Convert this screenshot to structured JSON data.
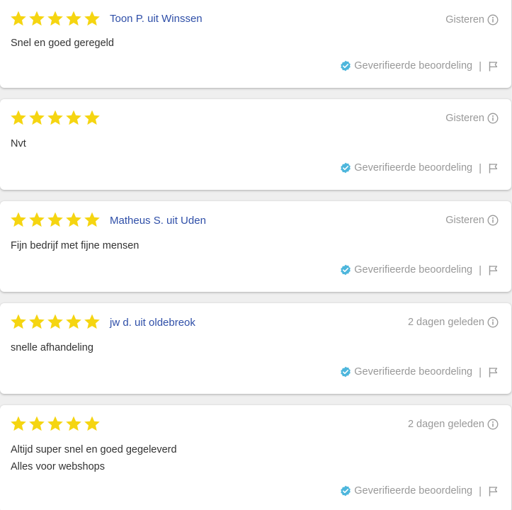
{
  "colors": {
    "star": "#f5d511",
    "author": "#2f4fa8",
    "muted": "#999999",
    "verified_badge": "#4db6dc"
  },
  "reviews": [
    {
      "stars": 5,
      "author": "Toon P. uit Winssen",
      "date": "Gisteren",
      "lines": [
        "Snel en goed geregeld"
      ],
      "verified_label": "Geverifieerde beoordeling",
      "separator": "|"
    },
    {
      "stars": 5,
      "author": "",
      "date": "Gisteren",
      "lines": [
        "Nvt"
      ],
      "verified_label": "Geverifieerde beoordeling",
      "separator": "|"
    },
    {
      "stars": 5,
      "author": "Matheus S. uit Uden",
      "date": "Gisteren",
      "lines": [
        "Fijn bedrijf met fijne mensen"
      ],
      "verified_label": "Geverifieerde beoordeling",
      "separator": "|"
    },
    {
      "stars": 5,
      "author": "jw d. uit oldebreok",
      "date": "2 dagen geleden",
      "lines": [
        "snelle afhandeling"
      ],
      "verified_label": "Geverifieerde beoordeling",
      "separator": "|"
    },
    {
      "stars": 5,
      "author": "",
      "date": "2 dagen geleden",
      "lines": [
        "Altijd super snel en goed gegeleverd",
        "Alles voor webshops"
      ],
      "verified_label": "Geverifieerde beoordeling",
      "separator": "|"
    }
  ]
}
